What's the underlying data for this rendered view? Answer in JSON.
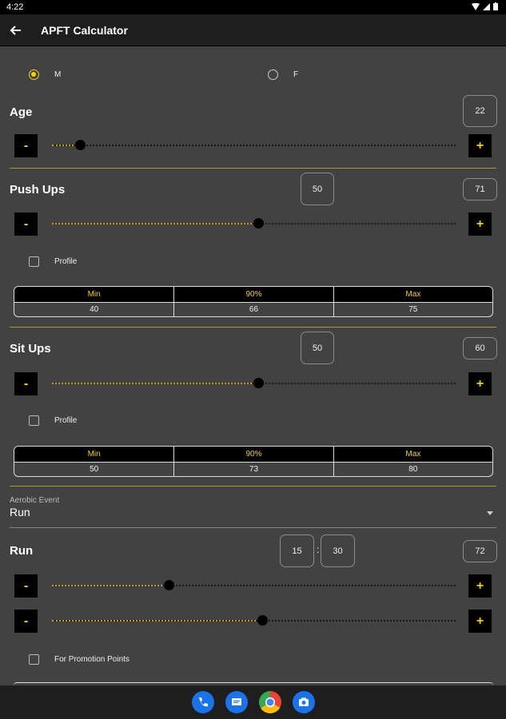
{
  "status": {
    "time": "4:22"
  },
  "appbar": {
    "title": "APFT Calculator"
  },
  "gender": {
    "male": "M",
    "female": "F",
    "selected": "M"
  },
  "age": {
    "label": "Age",
    "value": "22",
    "slider_fraction": 0.07
  },
  "pushups": {
    "label": "Push Ups",
    "reps": "50",
    "score": "71",
    "slider_fraction": 0.51,
    "profile_label": "Profile",
    "table": {
      "headers": [
        "Min",
        "90%",
        "Max"
      ],
      "values": [
        "40",
        "66",
        "75"
      ]
    }
  },
  "situps": {
    "label": "Sit Ups",
    "reps": "50",
    "score": "60",
    "slider_fraction": 0.51,
    "profile_label": "Profile",
    "table": {
      "headers": [
        "Min",
        "90%",
        "Max"
      ],
      "values": [
        "50",
        "73",
        "80"
      ]
    }
  },
  "aerobic": {
    "caption": "Aerobic Event",
    "value": "Run"
  },
  "run": {
    "label": "Run",
    "minutes": "15",
    "seconds": "30",
    "score": "72",
    "minutes_fraction": 0.29,
    "seconds_fraction": 0.52,
    "promotion_label": "For Promotion Points"
  },
  "buttons": {
    "minus": "-",
    "plus": "+"
  },
  "colors": {
    "accent": "#f4d20b",
    "background": "#424242",
    "bar": "#1e1e1e"
  }
}
